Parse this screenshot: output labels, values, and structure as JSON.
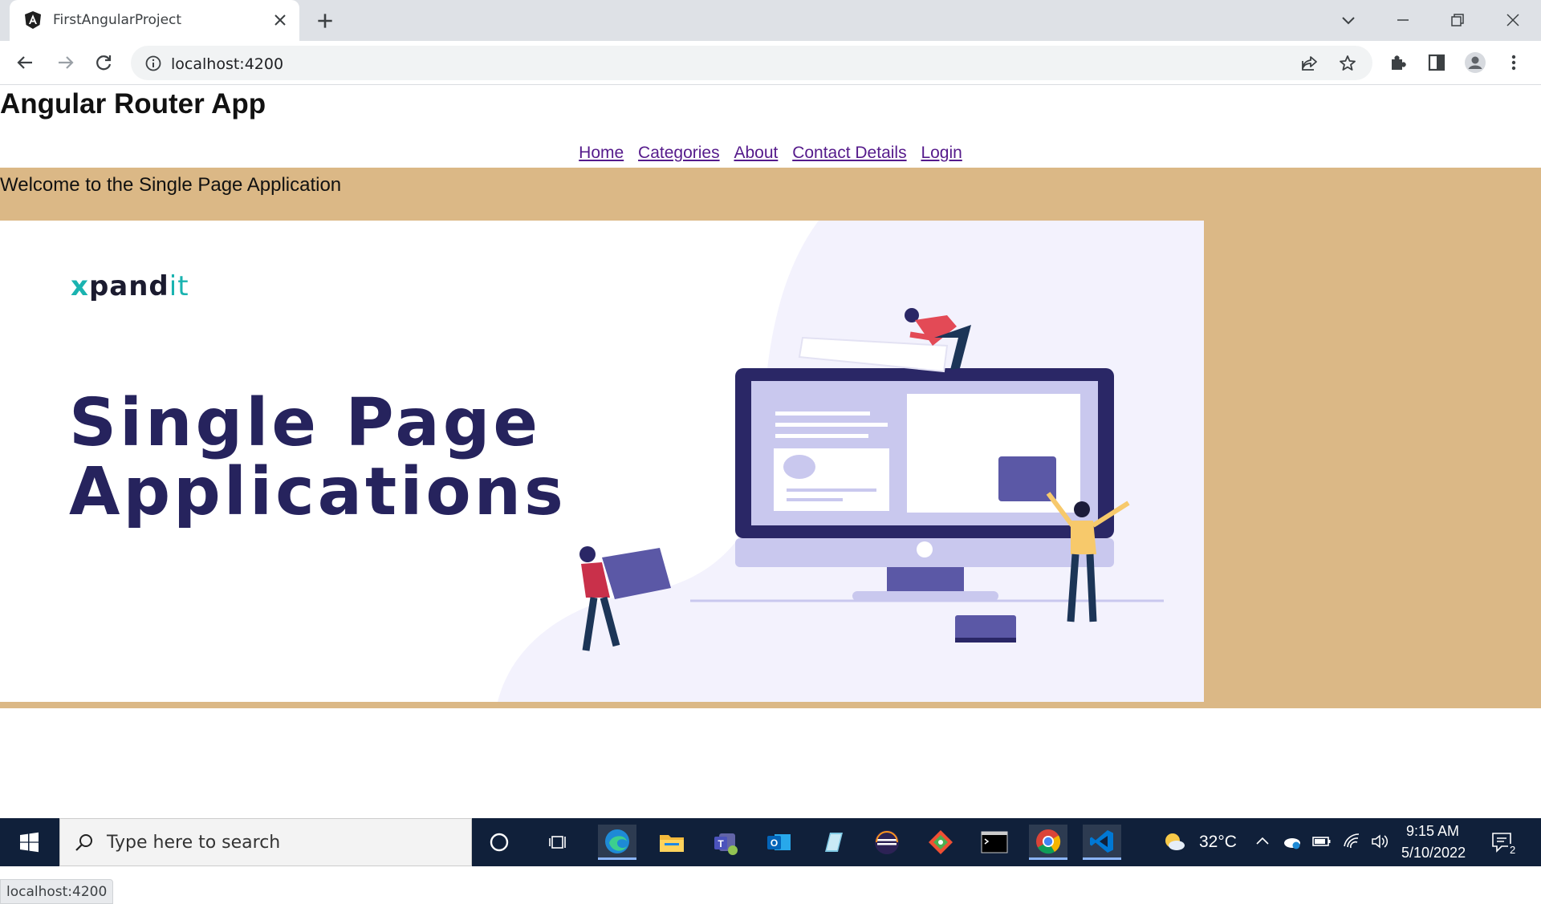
{
  "browser": {
    "tab_title": "FirstAngularProject",
    "url": "localhost:4200",
    "status_url": "localhost:4200"
  },
  "page": {
    "app_title": "Angular Router App",
    "nav": [
      "Home",
      "Categories",
      "About",
      "Contact Details",
      "Login"
    ],
    "welcome": "Welcome to the Single Page Application",
    "hero": {
      "logo_x": "x",
      "logo_main": "pand",
      "logo_it": "it",
      "title_line1": "Single Page",
      "title_line2": "Applications"
    },
    "colors": {
      "content_bg": "#dbb886",
      "link": "#551a8b",
      "hero_title": "#26235d"
    }
  },
  "taskbar": {
    "search_placeholder": "Type here to search",
    "temperature": "32°C",
    "time": "9:15 AM",
    "date": "5/10/2022",
    "notification_count": "2",
    "apps": [
      "cortana-icon",
      "task-view-icon",
      "edge-icon",
      "file-explorer-icon",
      "teams-icon",
      "outlook-icon",
      "notepad-icon",
      "eclipse-icon",
      "git-icon",
      "terminal-icon",
      "chrome-icon",
      "vscode-icon"
    ]
  }
}
